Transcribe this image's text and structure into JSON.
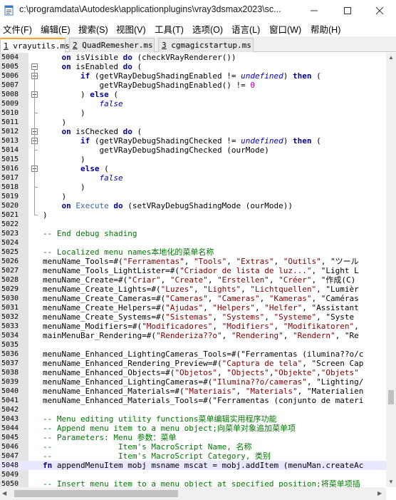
{
  "window": {
    "title": "c:\\programdata\\Autodesk\\applicationplugins\\vray3dsmax2023\\sc..."
  },
  "menu": [
    "文件(F)",
    "编辑(E)",
    "搜索(S)",
    "视图(V)",
    "工具(T)",
    "选项(O)",
    "语言(L)",
    "窗口(W)",
    "帮助(H)"
  ],
  "tabs": [
    {
      "num": "1",
      "label": " vrayutils.ms",
      "active": true
    },
    {
      "num": "2",
      "label": " QuadRemesher.ms",
      "active": false
    },
    {
      "num": "3",
      "label": " cgmagicstartup.ms",
      "active": false
    }
  ],
  "code": {
    "lines": [
      {
        "n": "5004",
        "t": "    on isVisible do (checkVRayRenderer())"
      },
      {
        "n": "5005",
        "t": "    on isEnabled do ("
      },
      {
        "n": "5006",
        "t": "        if (getVRayDebugShadingEnabled != undefined) then ("
      },
      {
        "n": "5007",
        "t": "            getVRayDebugShadingEnabled() != 0"
      },
      {
        "n": "5008",
        "t": "        ) else ("
      },
      {
        "n": "5009",
        "t": "            false"
      },
      {
        "n": "5010",
        "t": "        )"
      },
      {
        "n": "5011",
        "t": "    )"
      },
      {
        "n": "5012",
        "t": "    on isChecked do ("
      },
      {
        "n": "5013",
        "t": "        if (getVRayDebugShadingChecked != undefined) then ("
      },
      {
        "n": "5014",
        "t": "            getVRayDebugShadingChecked (ourMode)"
      },
      {
        "n": "5015",
        "t": "        )"
      },
      {
        "n": "5016",
        "t": "        else ("
      },
      {
        "n": "5017",
        "t": "            false"
      },
      {
        "n": "5018",
        "t": "        )"
      },
      {
        "n": "5019",
        "t": "    )"
      },
      {
        "n": "5020",
        "t": "    on Execute do (setVRayDebugShadingMode (ourMode))"
      },
      {
        "n": "5021",
        "t": ")"
      },
      {
        "n": "5022",
        "t": ""
      },
      {
        "n": "5023",
        "t": "-- End debug shading"
      },
      {
        "n": "5024",
        "t": ""
      },
      {
        "n": "5025",
        "t": "-- Localized menu names本地化的菜单名称"
      },
      {
        "n": "5026",
        "t": "menuName_Tools=#(\"Ferramentas\", \"Tools\", \"Extras\", \"Outils\", \"ツール"
      },
      {
        "n": "5027",
        "t": "menuName_Tools_LightLister=#(\"Criador de lista de luz...\", \"Light L"
      },
      {
        "n": "5028",
        "t": "menuName_Create=#(\"Criar\", \"Create\", \"Erstellen\", \"Créer\", \"作成(C)"
      },
      {
        "n": "5029",
        "t": "menuName_Create_Lights=#(\"Luzes\", \"Lights\", \"Lichtquellen\", \"Lumièr"
      },
      {
        "n": "5030",
        "t": "menuName_Create_Cameras=#(\"Cameras\", \"Cameras\", \"Kameras\", \"Caméras"
      },
      {
        "n": "5031",
        "t": "menuName_Create_Helpers=#(\"Ajudas\", \"Helpers\", \"Helfer\", \"Assistant"
      },
      {
        "n": "5032",
        "t": "menuName_Create_Systems=#(\"Sistemas\", \"Systems\", \"Systeme\", \"Syste"
      },
      {
        "n": "5033",
        "t": "menuName_Modifiers=#(\"Modificadores\", \"Modifiers\", \"Modifikatoren\","
      },
      {
        "n": "5034",
        "t": "mainMenuBar_Rendering=#(\"Renderiza??o\", \"Rendering\", \"Rendern\", \"Re"
      },
      {
        "n": "5035",
        "t": ""
      },
      {
        "n": "5036",
        "t": "menuName_Enhanced_LightingCameras_Tools=#(\"Ferramentas (ilumina??o/c"
      },
      {
        "n": "5037",
        "t": "menuName_Enhanced_Rendering_Preview=#(\"Captura de tela\", \"Screen Cap"
      },
      {
        "n": "5038",
        "t": "menuName_Enhanced_Objects=#(\"Objetos\", \"Objects\",\"Objekte\",\"Objets\""
      },
      {
        "n": "5039",
        "t": "menuName_Enhanced_LightingCameras=#(\"Ilumina??o/cameras\", \"Lighting/"
      },
      {
        "n": "5040",
        "t": "menuName_Enhanced_Materials=#(\"Materiais\", \"Materials\", \"Materialien"
      },
      {
        "n": "5041",
        "t": "menuName_Enhanced_Materials_Tools=#(\"Ferramentas (conjunto de materi"
      },
      {
        "n": "5042",
        "t": ""
      },
      {
        "n": "5043",
        "t": "-- Menu editing utility functions菜单编辑实用程序功能"
      },
      {
        "n": "5044",
        "t": "-- Append menu item to a menu object;向菜单对象追加菜单项"
      },
      {
        "n": "5045",
        "t": "-- Parameters: Menu 参数：菜单"
      },
      {
        "n": "5046",
        "t": "--              Item's MacroScript Name, 名称"
      },
      {
        "n": "5047",
        "t": "--              Item's MacroScript Category, 类别"
      },
      {
        "n": "5048",
        "t": "fn appendMenuItem mobj msname mscat = mobj.addItem (menuMan.createAc"
      },
      {
        "n": "5049",
        "t": ""
      },
      {
        "n": "5050",
        "t": "-- Insert menu item to a menu object at specified position;将菜单项插"
      }
    ]
  },
  "colors": {
    "keyword": "#00008b",
    "comment": "#007800",
    "string": "#800000",
    "italic_const": "#0000c8",
    "number": "#b000b0",
    "gutter": "#e4e4e4",
    "tab_accent": "#f5a623"
  }
}
